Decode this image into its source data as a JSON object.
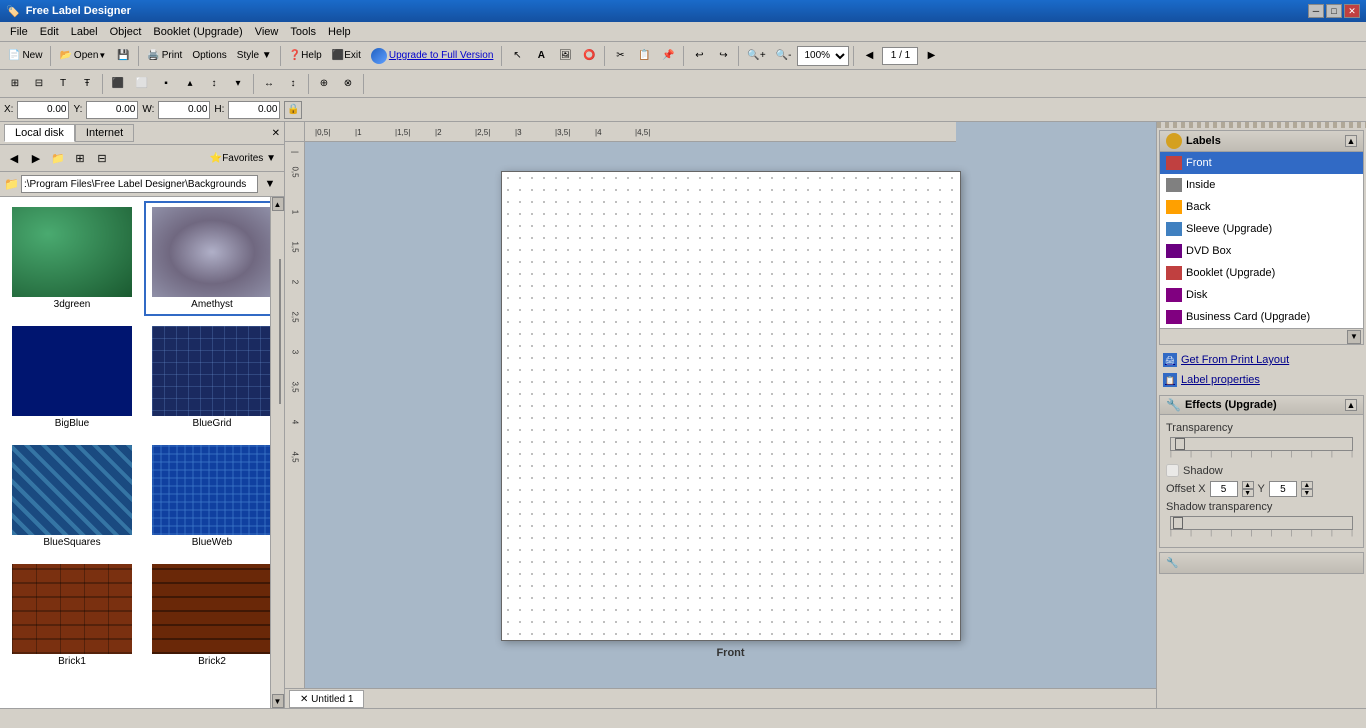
{
  "app": {
    "title": "Free Label Designer",
    "icon": "🏷️"
  },
  "titlebar": {
    "title": "Free Label Designer",
    "minimize": "─",
    "maximize": "□",
    "close": "✕"
  },
  "menubar": {
    "items": [
      "File",
      "Edit",
      "Label",
      "Object",
      "Booklet (Upgrade)",
      "View",
      "Tools",
      "Help"
    ]
  },
  "toolbar1": {
    "new": "New",
    "open": "Open",
    "save_icon": "💾",
    "print": "Print",
    "options": "Options",
    "style": "Style ▼",
    "help": "Help",
    "exit": "Exit",
    "upgrade": "Upgrade to Full Version",
    "zoom_in": "🔍",
    "zoom_out": "🔍",
    "zoom_value": "100%",
    "page": "1 / 1"
  },
  "coordbar": {
    "x_label": "X:",
    "x_value": "0.00",
    "y_label": "Y:",
    "y_value": "0.00",
    "w_label": "W:",
    "w_value": "0.00",
    "h_label": "H:",
    "h_value": "0.00"
  },
  "leftpanel": {
    "tab_localdisk": "Local disk",
    "tab_internet": "Internet",
    "path": ":\\Program Files\\Free Label Designer\\Backgrounds",
    "favorites": "Favorites ▼",
    "files": [
      {
        "name": "3dgreen",
        "color": "#2d7a4f"
      },
      {
        "name": "Amethyst",
        "color": "#9090a0"
      },
      {
        "name": "BigBlue",
        "color": "#002080"
      },
      {
        "name": "BlueGrid",
        "color": "#304080"
      },
      {
        "name": "BlueSquares",
        "color": "#4070b0"
      },
      {
        "name": "BlueWeb",
        "color": "#2060b0"
      },
      {
        "name": "Brick1",
        "color": "#8b4513"
      },
      {
        "name": "Brick2",
        "color": "#7a3810"
      }
    ]
  },
  "canvas": {
    "label": "Front",
    "tab": "✕ Untitled 1"
  },
  "rightpanel": {
    "labels_title": "Labels",
    "labels": [
      {
        "name": "Front",
        "type": "front",
        "selected": true
      },
      {
        "name": "Inside",
        "type": "inside"
      },
      {
        "name": "Back",
        "type": "back"
      },
      {
        "name": "Sleeve (Upgrade)",
        "type": "sleeve"
      },
      {
        "name": "DVD Box",
        "type": "dvd"
      },
      {
        "name": "Booklet (Upgrade)",
        "type": "booklet"
      },
      {
        "name": "Disk",
        "type": "disk"
      },
      {
        "name": "Business Card (Upgrade)",
        "type": "bizcard"
      }
    ],
    "get_from_print": "Get From Print Layout",
    "label_properties": "Label properties",
    "effects_title": "Effects (Upgrade)",
    "transparency_label": "Transparency",
    "shadow_label": "Shadow",
    "offset_x_label": "Offset X",
    "offset_x_value": "5",
    "offset_y_label": "Y",
    "offset_y_value": "5",
    "shadow_transparency_label": "Shadow transparency"
  },
  "colors": {
    "selected_bg": "#316ac5",
    "panel_bg": "#d4d0c8",
    "canvas_bg": "#a8b8c8"
  }
}
